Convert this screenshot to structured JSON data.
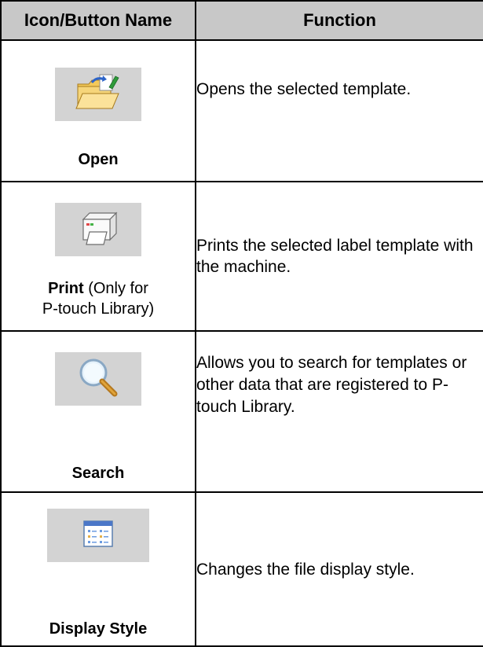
{
  "headers": {
    "col1": "Icon/Button Name",
    "col2": "Function"
  },
  "rows": [
    {
      "icon": "open-folder-icon",
      "name_bold": "Open",
      "name_suffix": "",
      "name_line2": "",
      "function": "Opens the selected template."
    },
    {
      "icon": "printer-icon",
      "name_bold": "Print",
      "name_suffix": " (Only for",
      "name_line2": "P-touch Library)",
      "function": "Prints the selected label template with the machine."
    },
    {
      "icon": "magnifier-icon",
      "name_bold": "Search",
      "name_suffix": "",
      "name_line2": "",
      "function": "Allows you to search for templates or other data that are registered to P-touch Library."
    },
    {
      "icon": "display-style-icon",
      "name_bold": "Display Style",
      "name_suffix": "",
      "name_line2": "",
      "function": "Changes the file display style."
    }
  ],
  "colors": {
    "header_bg": "#c8c8c8",
    "icon_bg": "#d3d3d3",
    "border": "#000000"
  }
}
